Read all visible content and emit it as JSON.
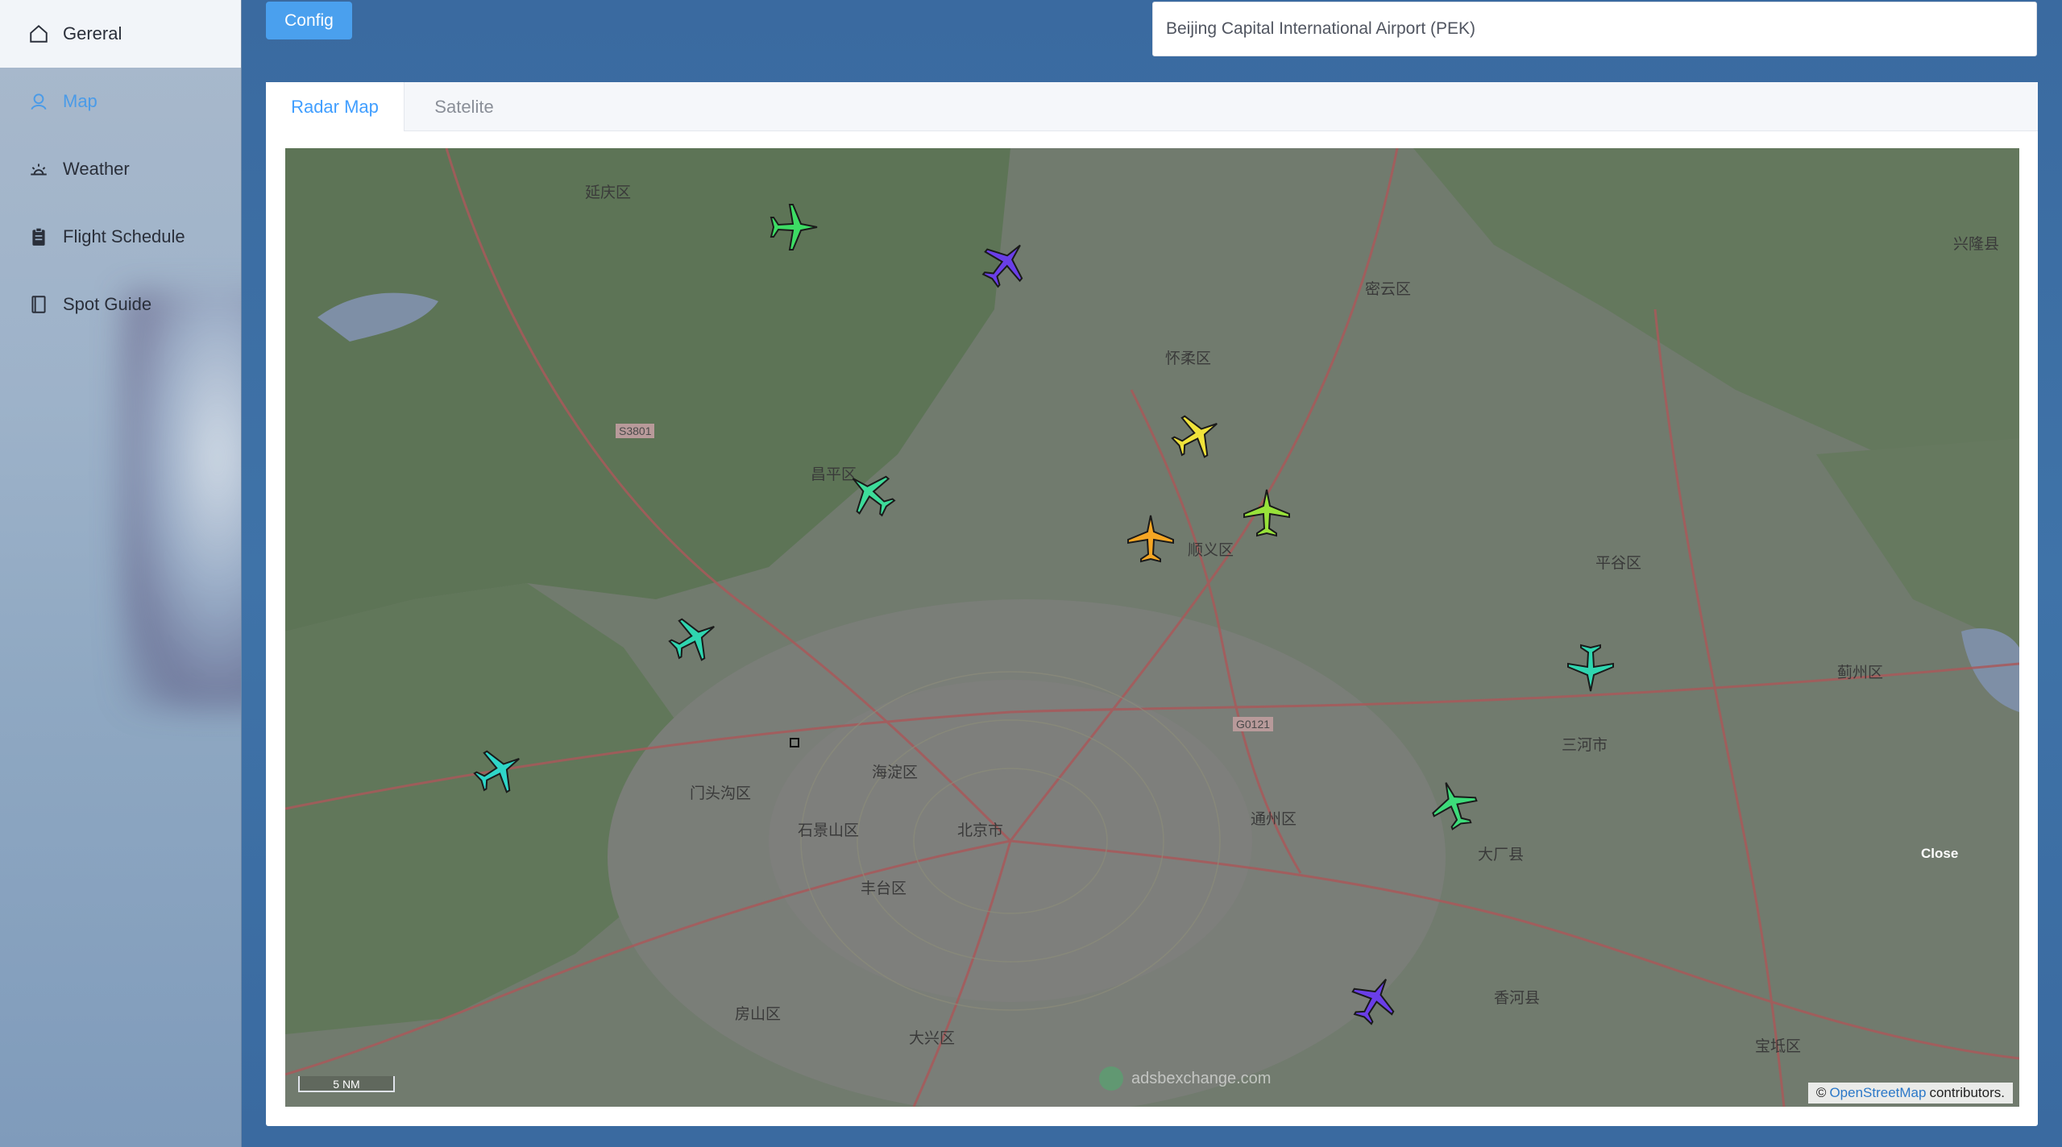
{
  "sidebar": {
    "items": [
      {
        "label": "Gereral",
        "icon": "home-icon"
      },
      {
        "label": "Map",
        "icon": "map-pin-icon"
      },
      {
        "label": "Weather",
        "icon": "sunrise-icon"
      },
      {
        "label": "Flight Schedule",
        "icon": "clipboard-icon"
      },
      {
        "label": "Spot Guide",
        "icon": "book-icon"
      }
    ]
  },
  "header": {
    "config_label": "Config",
    "airport_value": "Beijing Capital International Airport (PEK)"
  },
  "tabs": [
    {
      "label": "Radar Map"
    },
    {
      "label": "Satelite"
    }
  ],
  "map": {
    "scale_label": "5 NM",
    "watermark": "adsbexchange.com",
    "close_label": "Close",
    "attribution": {
      "prefix": "©",
      "link": "OpenStreetMap",
      "suffix": "contributors."
    },
    "labels": {
      "yanqing": "延庆区",
      "changping": "昌平区",
      "huairou": "怀柔区",
      "miyun": "密云区",
      "shunyi": "顺义区",
      "pinggu": "平谷区",
      "haidian": "海淀区",
      "mentougou": "门头沟区",
      "shijingshan": "石景山区",
      "beijing": "北京市",
      "fengtai": "丰台区",
      "tongzhou": "通州区",
      "fangshan": "房山区",
      "daxing": "大兴区",
      "sanhe": "三河市",
      "dachang": "大厂县",
      "xianghe": "香河县",
      "baodi": "宝坻区",
      "jizhou": "蓟州区",
      "xinglong": "兴隆县",
      "road_s3801": "S3801",
      "road_g0121": "G0121"
    },
    "aircraft_colors": [
      "#3ddc64",
      "#6a3ee8",
      "#f0e33a",
      "#3ddc9a",
      "#f5a623",
      "#98e23a",
      "#2fd6b0",
      "#2fd6c8",
      "#2fd6b0",
      "#3ddc7a",
      "#6a3ee8"
    ]
  }
}
